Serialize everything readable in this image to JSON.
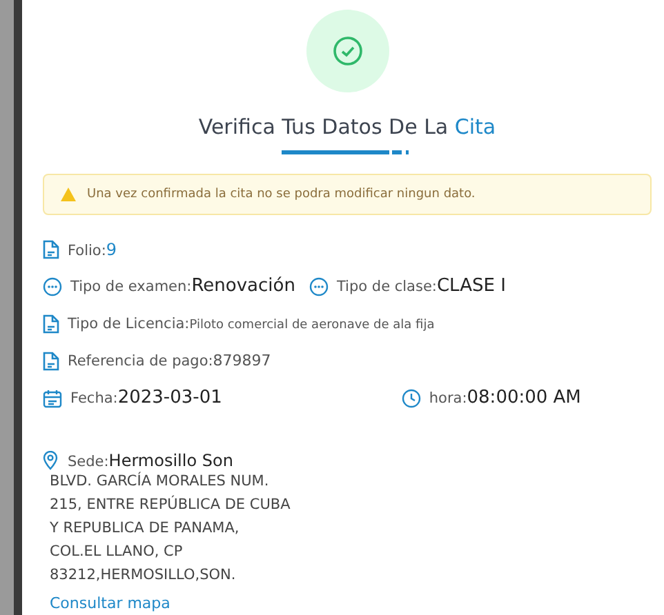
{
  "header": {
    "title": "Verifica Tus Datos De La **Cita**"
  },
  "alert": {
    "text": "Una vez confirmada la cita no se podra modificar ningun dato."
  },
  "rows": [
    {
      "items": [
        {
          "kind": "number",
          "label": "Folio:",
          "value": "9"
        }
      ]
    },
    {
      "items": [
        {
          "kind": "choice",
          "label": "Tipo de examen:",
          "value": "Renovación"
        },
        {
          "kind": "choice",
          "label": "Tipo de clase:",
          "value": "CLASE I"
        }
      ]
    },
    {
      "items": [
        {
          "kind": "licence",
          "label": "Tipo de Licencia:",
          "value": "Piloto comercial de aeronave de ala fija"
        }
      ]
    },
    {
      "items": [
        {
          "kind": "reference",
          "label": "Referencia de pago:",
          "value": "879897"
        }
      ]
    },
    {
      "items": [
        {
          "kind": "date",
          "label": "Fecha:",
          "value": "2023-03-01"
        },
        {
          "kind": "time",
          "label": "hora:",
          "value": "08:00:00 AM"
        }
      ]
    }
  ],
  "sede": {
    "label": "Sede:",
    "name": "Hermosillo Son",
    "address_lines": [
      "BLVD. GARCÍA MORALES NUM.",
      "215, ENTRE REPÚBLICA DE CUBA",
      "Y REPUBLICA DE PANAMA,",
      "COL.EL LLANO, CP",
      "83212,HERMOSILLO,SON."
    ],
    "link": "Consultar mapa"
  }
}
